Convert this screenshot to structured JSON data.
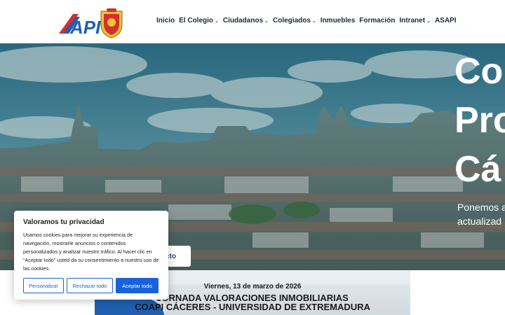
{
  "header": {
    "logo_text": "API",
    "nav": [
      {
        "label": "Inicio",
        "dropdown": false
      },
      {
        "label": "El Colegio",
        "dropdown": true
      },
      {
        "label": "Ciudadanos",
        "dropdown": true
      },
      {
        "label": "Colegiados",
        "dropdown": true
      },
      {
        "label": "Inmuebles",
        "dropdown": false
      },
      {
        "label": "Formación",
        "dropdown": false
      },
      {
        "label": "Intranet",
        "dropdown": true
      },
      {
        "label": "ASAPI",
        "dropdown": false
      }
    ]
  },
  "hero": {
    "title_lines": [
      "Co",
      "Pro",
      "Cá"
    ],
    "subtitle_lines": [
      "Ponemos a",
      "actualizad"
    ],
    "button_label": "cto"
  },
  "banner": {
    "date": "Viernes, 13 de marzo de 2026",
    "line1": "JORNADA VALORACIONES INMOBILIARIAS",
    "line2": "COAPI CÁCERES - UNIVERSIDAD DE EXTREMADURA"
  },
  "cookie": {
    "title": "Valoramos tu privacidad",
    "text": "Usamos cookies para mejorar su experiencia de navegación, mostrarle anuncios o contenidos personalizados y analizar nuestro tráfico. Al hacer clic en “Aceptar todo” usted da su consentimiento a nuestro uso de las cookies.",
    "btn_customize": "Personalizar",
    "btn_reject": "Rechazar todo",
    "btn_accept": "Aceptar todo"
  },
  "colors": {
    "brand_blue": "#1f5fb0",
    "brand_red": "#d32f2f",
    "accent": "#1863dc"
  }
}
